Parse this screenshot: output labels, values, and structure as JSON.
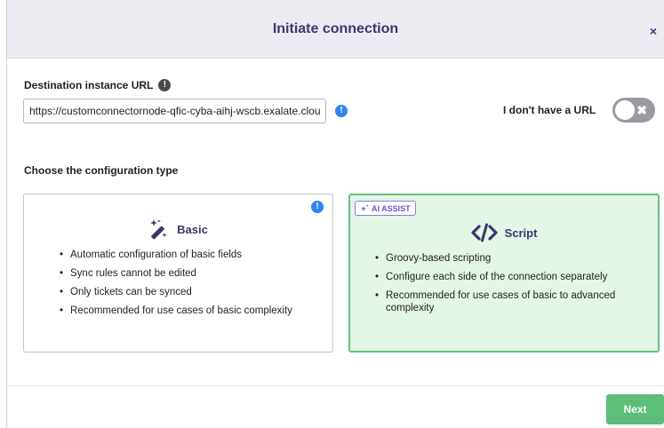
{
  "dialog": {
    "title": "Initiate connection",
    "close_glyph": "×"
  },
  "destination": {
    "label": "Destination instance URL",
    "label_info_icon": "info-icon",
    "input_value": "https://customconnectornode-qfic-cyba-aihj-wscb.exalate.cloud",
    "warning_icon": "info-icon",
    "no_url_label": "I don't have a URL",
    "toggle_state": "off"
  },
  "configuration": {
    "label": "Choose the configuration type",
    "cards": [
      {
        "id": "basic",
        "label": "Basic",
        "icon": "magic-wand-icon",
        "selected": false,
        "badge": null,
        "items": [
          "Automatic configuration of basic fields",
          "Sync rules cannot be edited",
          "Only tickets can be synced",
          "Recommended for use cases of basic complexity"
        ]
      },
      {
        "id": "script",
        "label": "Script",
        "icon": "code-icon",
        "selected": true,
        "badge": "AI ASSIST",
        "items": [
          "Groovy-based scripting",
          "Configure each side of the connection separately",
          "Recommended for use cases of basic to advanced complexity"
        ]
      }
    ]
  },
  "footer": {
    "next_label": "Next"
  },
  "colors": {
    "header_bg": "#ececf2",
    "title": "#3b3670",
    "info_blue": "#2e86f0",
    "selected_bg": "#e4f6e6",
    "selected_border": "#63c27a",
    "next_button": "#5cbe78",
    "ai_badge": "#6b55d6"
  }
}
